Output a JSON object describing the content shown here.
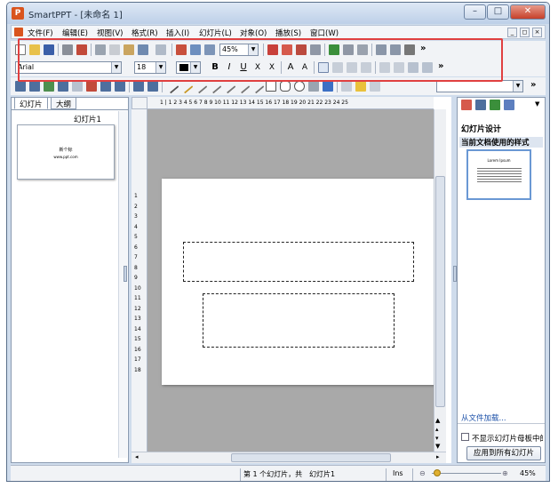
{
  "window": {
    "title": "SmartPPT - [未命名 1]",
    "app_icon": "P"
  },
  "menu": [
    "文件(F)",
    "编辑(E)",
    "视图(V)",
    "格式(R)",
    "插入(I)",
    "幻灯片(L)",
    "对象(O)",
    "播放(S)",
    "窗口(W)"
  ],
  "toolbar": {
    "zoom": "45%",
    "font": "Arial",
    "font_size": "18",
    "more": "»"
  },
  "left_pane": {
    "tabs": [
      "幻灯片",
      "大纲"
    ],
    "slide_label": "幻灯片1",
    "thumb_title": "新个标",
    "thumb_sub": "www.ppt.com"
  },
  "hruler_text": "1 | 1 2 3 4 5 6 7 8 9 10 11 12 13 14 15 16 17 18 19 20 21 22 23 24 25",
  "vruler": [
    "1",
    "2",
    "3",
    "4",
    "5",
    "6",
    "7",
    "8",
    "9",
    "10",
    "11",
    "12",
    "13",
    "14",
    "15",
    "16",
    "17",
    "18"
  ],
  "right_pane": {
    "section": "幻灯片设计",
    "subsection": "当前文档使用的样式",
    "template_title": "Lorem Ipsum",
    "load_link": "从文件加载...",
    "checkbox_label": "不显示幻灯片母板中的",
    "apply_button": "应用到所有幻灯片"
  },
  "status": {
    "slide_info": "第 1 个幻灯片，共",
    "slide_name": "幻灯片1",
    "ins": "Ins",
    "zoom": "45%"
  }
}
